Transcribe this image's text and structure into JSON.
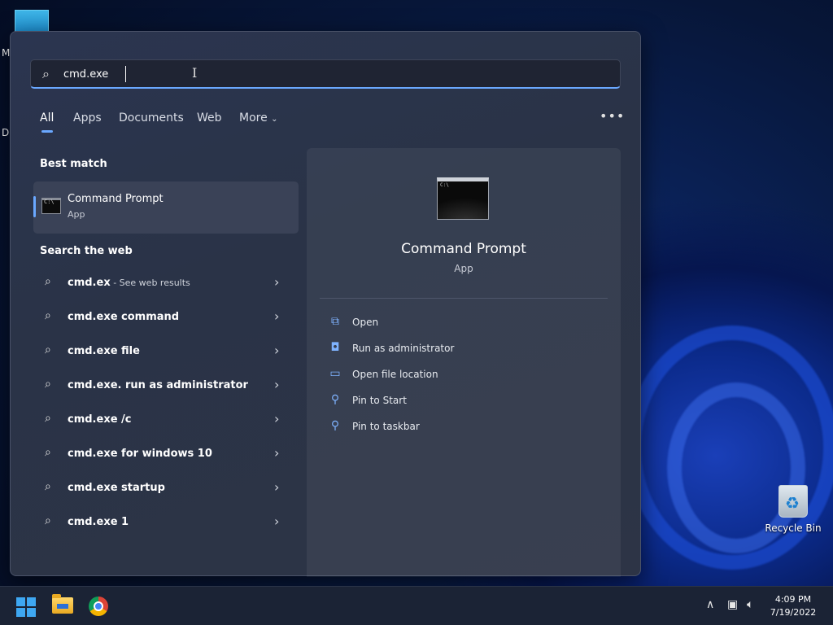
{
  "desktop": {
    "edge_text_1": "M",
    "edge_text_2": "D",
    "recycle_bin_label": "Recycle Bin"
  },
  "search": {
    "value": "cmd.exe",
    "placeholder": ""
  },
  "tabs": [
    {
      "label": "All",
      "active": true
    },
    {
      "label": "Apps"
    },
    {
      "label": "Documents"
    },
    {
      "label": "Web"
    },
    {
      "label": "More"
    }
  ],
  "best_match": {
    "section_title": "Best match",
    "name": "Command Prompt",
    "type": "App"
  },
  "web": {
    "section_title": "Search the web",
    "items": [
      {
        "query": "cmd.ex",
        "hint": " - See web results"
      },
      {
        "query": "cmd.exe command"
      },
      {
        "query": "cmd.exe file"
      },
      {
        "query": "cmd.exe. run as administrator"
      },
      {
        "query": "cmd.exe /c"
      },
      {
        "query": "cmd.exe for windows 10"
      },
      {
        "query": "cmd.exe startup"
      },
      {
        "query": "cmd.exe 1"
      }
    ]
  },
  "preview": {
    "title": "Command Prompt",
    "subtitle": "App",
    "actions": [
      {
        "label": "Open",
        "icon": "open-icon"
      },
      {
        "label": "Run as administrator",
        "icon": "shield-icon"
      },
      {
        "label": "Open file location",
        "icon": "folder-icon"
      },
      {
        "label": "Pin to Start",
        "icon": "pin-icon"
      },
      {
        "label": "Pin to taskbar",
        "icon": "pin-icon"
      }
    ]
  },
  "taskbar": {
    "time": "4:09 PM",
    "date": "7/19/2022"
  },
  "colors": {
    "accent": "#6aa8ff",
    "panel": "#2b3550"
  }
}
